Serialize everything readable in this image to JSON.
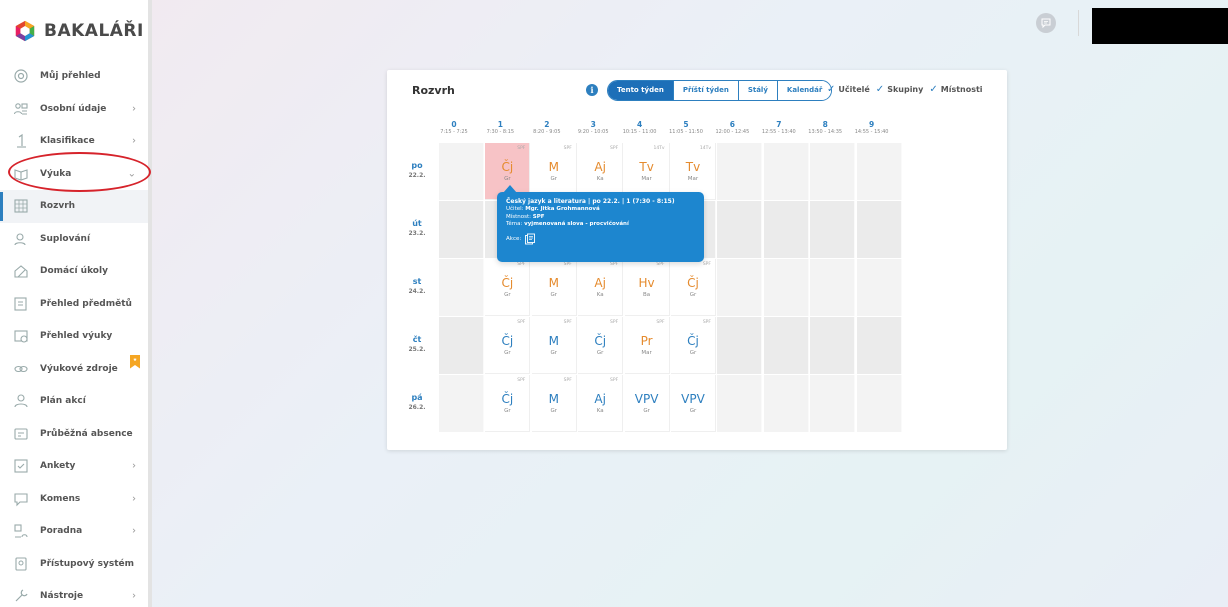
{
  "app": {
    "brand": "BAKALÁŘI"
  },
  "sidebar": {
    "items": [
      {
        "label": "Můj přehled",
        "icon": "gauge-icon",
        "chevron": false
      },
      {
        "label": "Osobní údaje",
        "icon": "people-icon",
        "chevron": true
      },
      {
        "label": "Klasifikace",
        "icon": "grade-icon",
        "chevron": true
      },
      {
        "label": "Výuka",
        "icon": "book-icon",
        "chevron": true,
        "expanded": true
      },
      {
        "label": "Rozvrh",
        "icon": "timetable-icon",
        "chevron": false,
        "active": true
      },
      {
        "label": "Suplování",
        "icon": "substitution-icon",
        "chevron": false
      },
      {
        "label": "Domácí úkoly",
        "icon": "homework-icon",
        "chevron": false
      },
      {
        "label": "Přehled předmětů",
        "icon": "subjects-icon",
        "chevron": false
      },
      {
        "label": "Přehled výuky",
        "icon": "lessons-icon",
        "chevron": false
      },
      {
        "label": "Výukové zdroje",
        "icon": "link-icon",
        "chevron": false,
        "bookmark": true
      },
      {
        "label": "Plán akcí",
        "icon": "events-icon",
        "chevron": false
      },
      {
        "label": "Průběžná absence",
        "icon": "absence-icon",
        "chevron": false
      },
      {
        "label": "Ankety",
        "icon": "poll-icon",
        "chevron": true
      },
      {
        "label": "Komens",
        "icon": "message-icon",
        "chevron": true
      },
      {
        "label": "Poradna",
        "icon": "counsel-icon",
        "chevron": true
      },
      {
        "label": "Přístupový systém",
        "icon": "access-icon",
        "chevron": false
      },
      {
        "label": "Nástroje",
        "icon": "tools-icon",
        "chevron": true
      }
    ]
  },
  "timetable": {
    "title": "Rozvrh",
    "view_buttons": [
      "Tento týden",
      "Příští týden",
      "Stálý",
      "Kalendář"
    ],
    "active_view": "Tento týden",
    "toggles": [
      "Učitelé",
      "Skupiny",
      "Místnosti"
    ],
    "hours": [
      {
        "n": "0",
        "t": "7:15 - 7:25"
      },
      {
        "n": "1",
        "t": "7:30 - 8:15"
      },
      {
        "n": "2",
        "t": "8:20 - 9:05"
      },
      {
        "n": "3",
        "t": "9:20 - 10:05"
      },
      {
        "n": "4",
        "t": "10:15 - 11:00"
      },
      {
        "n": "5",
        "t": "11:05 - 11:50"
      },
      {
        "n": "6",
        "t": "12:00 - 12:45"
      },
      {
        "n": "7",
        "t": "12:55 - 13:40"
      },
      {
        "n": "8",
        "t": "13:50 - 14:35"
      },
      {
        "n": "9",
        "t": "14:55 - 15:40"
      }
    ],
    "days": [
      {
        "d": "po",
        "date": "22.2.",
        "lessons": [
          {
            "slot": 1,
            "subj": "Čj",
            "teach": "Gr",
            "room": "SPF",
            "color": "orange",
            "selected": true
          },
          {
            "slot": 2,
            "subj": "M",
            "teach": "Gr",
            "room": "SPF",
            "color": "orange"
          },
          {
            "slot": 3,
            "subj": "Aj",
            "teach": "Ka",
            "room": "SPF",
            "color": "orange"
          },
          {
            "slot": 4,
            "subj": "Tv",
            "teach": "Mar",
            "room": "14Tv",
            "color": "orange"
          },
          {
            "slot": 5,
            "subj": "Tv",
            "teach": "Mar",
            "room": "14Tv",
            "color": "orange"
          }
        ]
      },
      {
        "d": "út",
        "date": "23.2.",
        "lessons": []
      },
      {
        "d": "st",
        "date": "24.2.",
        "lessons": [
          {
            "slot": 1,
            "subj": "Čj",
            "teach": "Gr",
            "room": "SPF",
            "color": "orange"
          },
          {
            "slot": 2,
            "subj": "M",
            "teach": "Gr",
            "room": "SPF",
            "color": "orange"
          },
          {
            "slot": 3,
            "subj": "Aj",
            "teach": "Ka",
            "room": "SPF",
            "color": "orange"
          },
          {
            "slot": 4,
            "subj": "Hv",
            "teach": "Ba",
            "room": "SPF",
            "color": "orange"
          },
          {
            "slot": 5,
            "subj": "Čj",
            "teach": "Gr",
            "room": "SPF",
            "color": "orange"
          }
        ]
      },
      {
        "d": "čt",
        "date": "25.2.",
        "lessons": [
          {
            "slot": 1,
            "subj": "Čj",
            "teach": "Gr",
            "room": "SPF",
            "color": "blue"
          },
          {
            "slot": 2,
            "subj": "M",
            "teach": "Gr",
            "room": "SPF",
            "color": "blue"
          },
          {
            "slot": 3,
            "subj": "Čj",
            "teach": "Gr",
            "room": "SPF",
            "color": "blue"
          },
          {
            "slot": 4,
            "subj": "Pr",
            "teach": "Mar",
            "room": "SPF",
            "color": "orange"
          },
          {
            "slot": 5,
            "subj": "Čj",
            "teach": "Gr",
            "room": "SPF",
            "color": "blue"
          }
        ]
      },
      {
        "d": "pá",
        "date": "26.2.",
        "lessons": [
          {
            "slot": 1,
            "subj": "Čj",
            "teach": "Gr",
            "room": "SPF",
            "color": "blue"
          },
          {
            "slot": 2,
            "subj": "M",
            "teach": "Gr",
            "room": "SPF",
            "color": "blue"
          },
          {
            "slot": 3,
            "subj": "Aj",
            "teach": "Ka",
            "room": "SPF",
            "color": "blue"
          },
          {
            "slot": 4,
            "subj": "VPV",
            "teach": "Gr",
            "room": "",
            "color": "blue"
          },
          {
            "slot": 5,
            "subj": "VPV",
            "teach": "Gr",
            "room": "",
            "color": "blue"
          }
        ]
      }
    ],
    "tooltip": {
      "title": "Český jazyk a literatura | po 22.2. | 1 (7:30 - 8:15)",
      "teacher_label": "Učitel:",
      "teacher": "Mgr. Jitka Grohmannová",
      "room_label": "Místnost:",
      "room": "SPF",
      "topic_label": "Téma:",
      "topic": "vyjmenovaná slova - procvičování",
      "action_label": "Akce:"
    }
  },
  "colors": {
    "accent": "#2d7fbf",
    "orange": "#e58b2e",
    "selected": "#f7c3c6",
    "tooltip": "#1d86cf"
  }
}
